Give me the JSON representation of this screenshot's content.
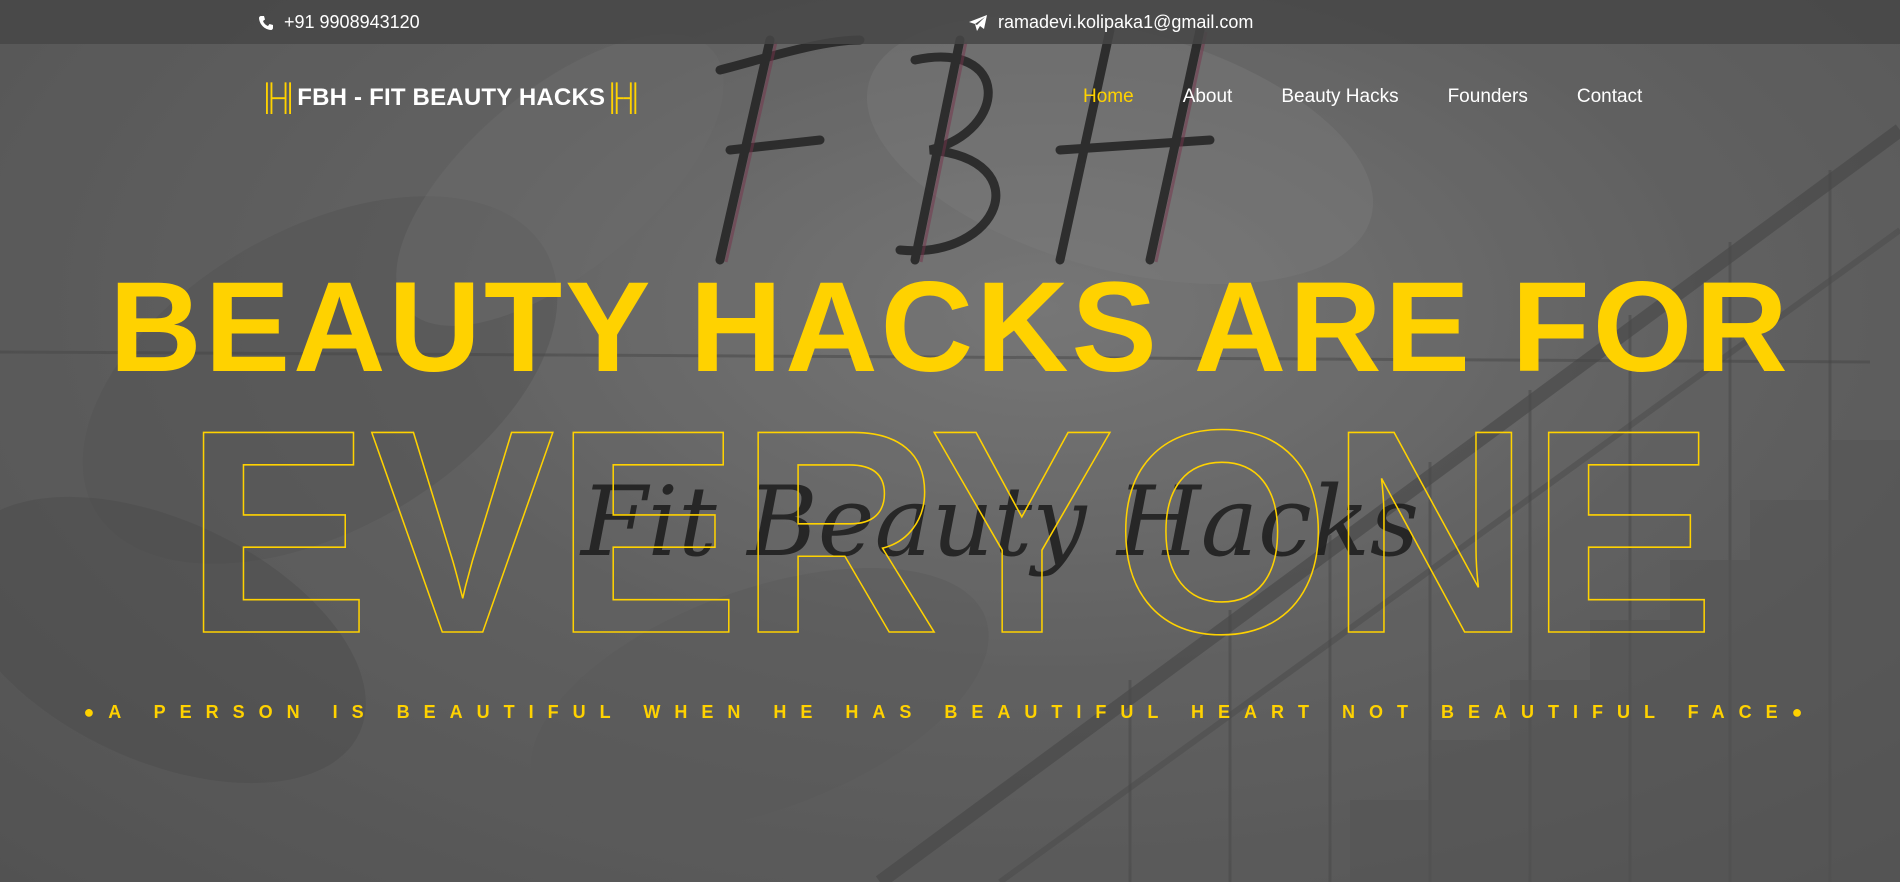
{
  "topbar": {
    "phone": "+91 9908943120",
    "email": "ramadevi.kolipaka1@gmail.com",
    "phone_icon": "phone-icon",
    "email_icon": "paper-plane-icon"
  },
  "brand": {
    "left_glyph": "╟╢",
    "text": "FBH - FIT BEAUTY HACKS",
    "right_glyph": "╟╢",
    "icon": "dumbbell-icon"
  },
  "nav": {
    "items": [
      {
        "label": "Home",
        "active": true
      },
      {
        "label": "About",
        "active": false
      },
      {
        "label": "Beauty Hacks",
        "active": false
      },
      {
        "label": "Founders",
        "active": false
      },
      {
        "label": "Contact",
        "active": false
      }
    ]
  },
  "hero": {
    "headline": "BEAUTY HACKS ARE FOR",
    "outline_word": "EVERYONE",
    "tagline": "●A PERSON IS BEAUTIFUL WHEN HE HAS BEAUTIFUL HEART NOT BEAUTIFUL FACE●"
  },
  "background": {
    "logo_monogram": "FBH",
    "logo_script": "Fit Beauty Hacks"
  },
  "colors": {
    "accent": "#ffd200",
    "text": "#ffffff",
    "topbar_bg": "#464646"
  }
}
